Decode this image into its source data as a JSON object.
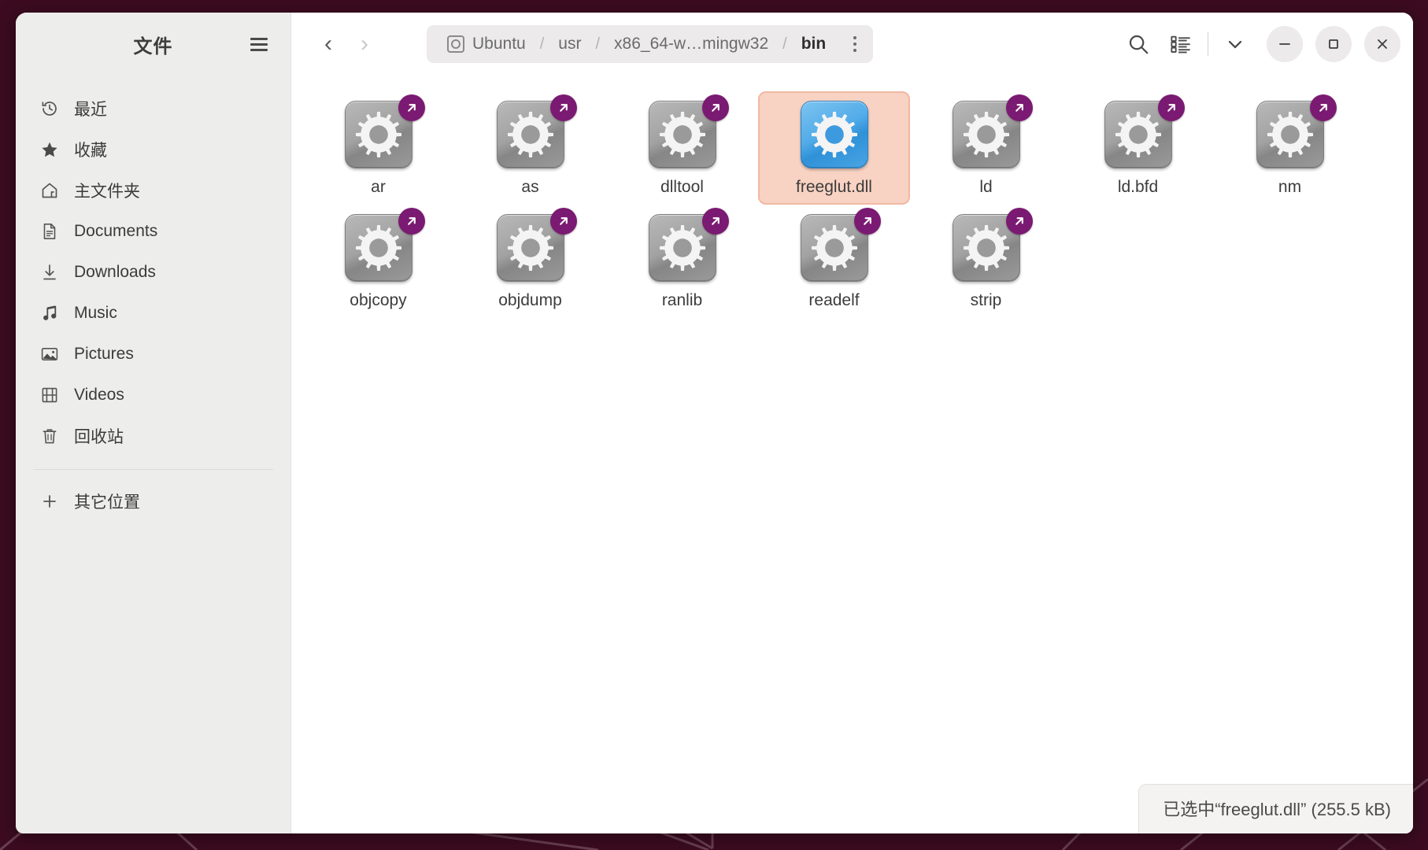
{
  "window": {
    "sidebar_title": "文件",
    "menu_icon": "hamburger-menu-icon"
  },
  "navigation": {
    "back_glyph": "‹",
    "forward_glyph": "›"
  },
  "pathbar": {
    "crumbs": [
      {
        "label": "Ubuntu",
        "icon": "drive-icon",
        "current": false
      },
      {
        "label": "usr",
        "icon": "",
        "current": false
      },
      {
        "label": "x86_64-w…mingw32",
        "icon": "",
        "current": false
      },
      {
        "label": "bin",
        "icon": "",
        "current": true
      }
    ],
    "separator": "/",
    "kebab_icon": "more-options-icon"
  },
  "toolbar": {
    "search_icon": "search-icon",
    "view_list_icon": "view-list-icon",
    "view_dropdown_icon": "chevron-down-icon",
    "minimize_glyph": "–",
    "maximize_glyph": "□",
    "close_glyph": "✕"
  },
  "sidebar": {
    "items": [
      {
        "label": "最近",
        "icon": "clock-history-icon"
      },
      {
        "label": "收藏",
        "icon": "star-icon"
      },
      {
        "label": "主文件夹",
        "icon": "home-icon"
      },
      {
        "label": "Documents",
        "icon": "document-icon"
      },
      {
        "label": "Downloads",
        "icon": "download-arrow-icon"
      },
      {
        "label": "Music",
        "icon": "music-note-icon"
      },
      {
        "label": "Pictures",
        "icon": "picture-icon"
      },
      {
        "label": "Videos",
        "icon": "film-icon"
      },
      {
        "label": "回收站",
        "icon": "trash-icon"
      }
    ],
    "other_locations": {
      "label": "其它位置",
      "icon": "plus-icon"
    }
  },
  "files": [
    {
      "name": "ar",
      "icon": "gear-app-icon",
      "symlink": true,
      "selected": false
    },
    {
      "name": "as",
      "icon": "gear-app-icon",
      "symlink": true,
      "selected": false
    },
    {
      "name": "dlltool",
      "icon": "gear-app-icon",
      "symlink": true,
      "selected": false
    },
    {
      "name": "freeglut.dll",
      "icon": "gear-app-icon",
      "symlink": false,
      "selected": true
    },
    {
      "name": "ld",
      "icon": "gear-app-icon",
      "symlink": true,
      "selected": false
    },
    {
      "name": "ld.bfd",
      "icon": "gear-app-icon",
      "symlink": true,
      "selected": false
    },
    {
      "name": "nm",
      "icon": "gear-app-icon",
      "symlink": true,
      "selected": false
    },
    {
      "name": "objcopy",
      "icon": "gear-app-icon",
      "symlink": true,
      "selected": false
    },
    {
      "name": "objdump",
      "icon": "gear-app-icon",
      "symlink": true,
      "selected": false
    },
    {
      "name": "ranlib",
      "icon": "gear-app-icon",
      "symlink": true,
      "selected": false
    },
    {
      "name": "readelf",
      "icon": "gear-app-icon",
      "symlink": true,
      "selected": false
    },
    {
      "name": "strip",
      "icon": "gear-app-icon",
      "symlink": true,
      "selected": false
    }
  ],
  "statusbar": {
    "text": "已选中“freeglut.dll” (255.5 kB)"
  },
  "colors": {
    "desktop": "#3d0b21",
    "sidebar_bg": "#ededeb",
    "selection_bg": "#f8d2c2",
    "symlink_badge": "#7b1a72",
    "selected_icon": "#51abe8"
  }
}
